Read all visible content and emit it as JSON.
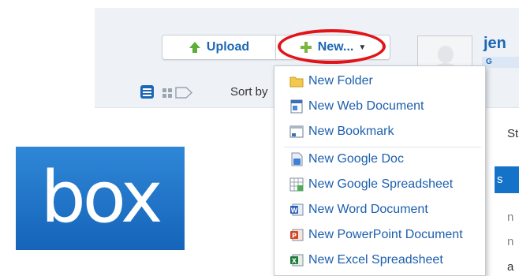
{
  "header": {
    "upload_label": "Upload",
    "new_label": "New...",
    "username": "jen",
    "user_badge": "G"
  },
  "viewbar": {
    "sort_label": "Sort by"
  },
  "right_fragments": {
    "st": "St",
    "s": "s",
    "n1": "n",
    "n2": "n",
    "a": "a"
  },
  "logo": {
    "text": "box"
  },
  "new_menu": {
    "items": [
      {
        "label": "New Folder",
        "icon": "folder-icon"
      },
      {
        "label": "New Web Document",
        "icon": "web-document-icon"
      },
      {
        "label": "New Bookmark",
        "icon": "bookmark-icon"
      },
      {
        "label": "New Google Doc",
        "icon": "google-doc-icon"
      },
      {
        "label": "New Google Spreadsheet",
        "icon": "google-spreadsheet-icon"
      },
      {
        "label": "New Word Document",
        "icon": "word-icon"
      },
      {
        "label": "New PowerPoint Document",
        "icon": "powerpoint-icon"
      },
      {
        "label": "New Excel Spreadsheet",
        "icon": "excel-icon"
      }
    ]
  },
  "colors": {
    "link_blue": "#1c66b5",
    "highlight_red": "#e1141a",
    "logo_blue": "#1f72c6"
  }
}
